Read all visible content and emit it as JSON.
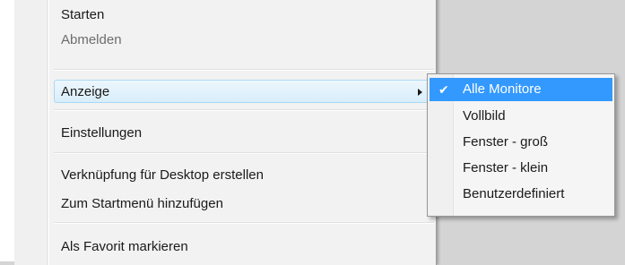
{
  "menu": {
    "items": [
      {
        "label": "Starten",
        "disabled": false
      },
      {
        "label": "Abmelden",
        "disabled": true
      },
      {
        "label": "Anzeige",
        "has_submenu": true
      },
      {
        "label": "Einstellungen"
      },
      {
        "label": "Verknüpfung für Desktop erstellen"
      },
      {
        "label": "Zum Startmenü hinzufügen"
      },
      {
        "label": "Als Favorit markieren"
      }
    ]
  },
  "submenu": {
    "items": [
      {
        "label": "Alle Monitore",
        "checked": true
      },
      {
        "label": "Vollbild"
      },
      {
        "label": "Fenster - groß"
      },
      {
        "label": "Fenster - klein"
      },
      {
        "label": "Benutzerdefiniert"
      }
    ]
  },
  "icons": {
    "check": "✔",
    "submenu_arrow": "chevron-right-icon"
  },
  "colors": {
    "selection": "#3399ff",
    "hover_border": "#a8d8f3",
    "disabled_text": "#6d6d6d"
  }
}
